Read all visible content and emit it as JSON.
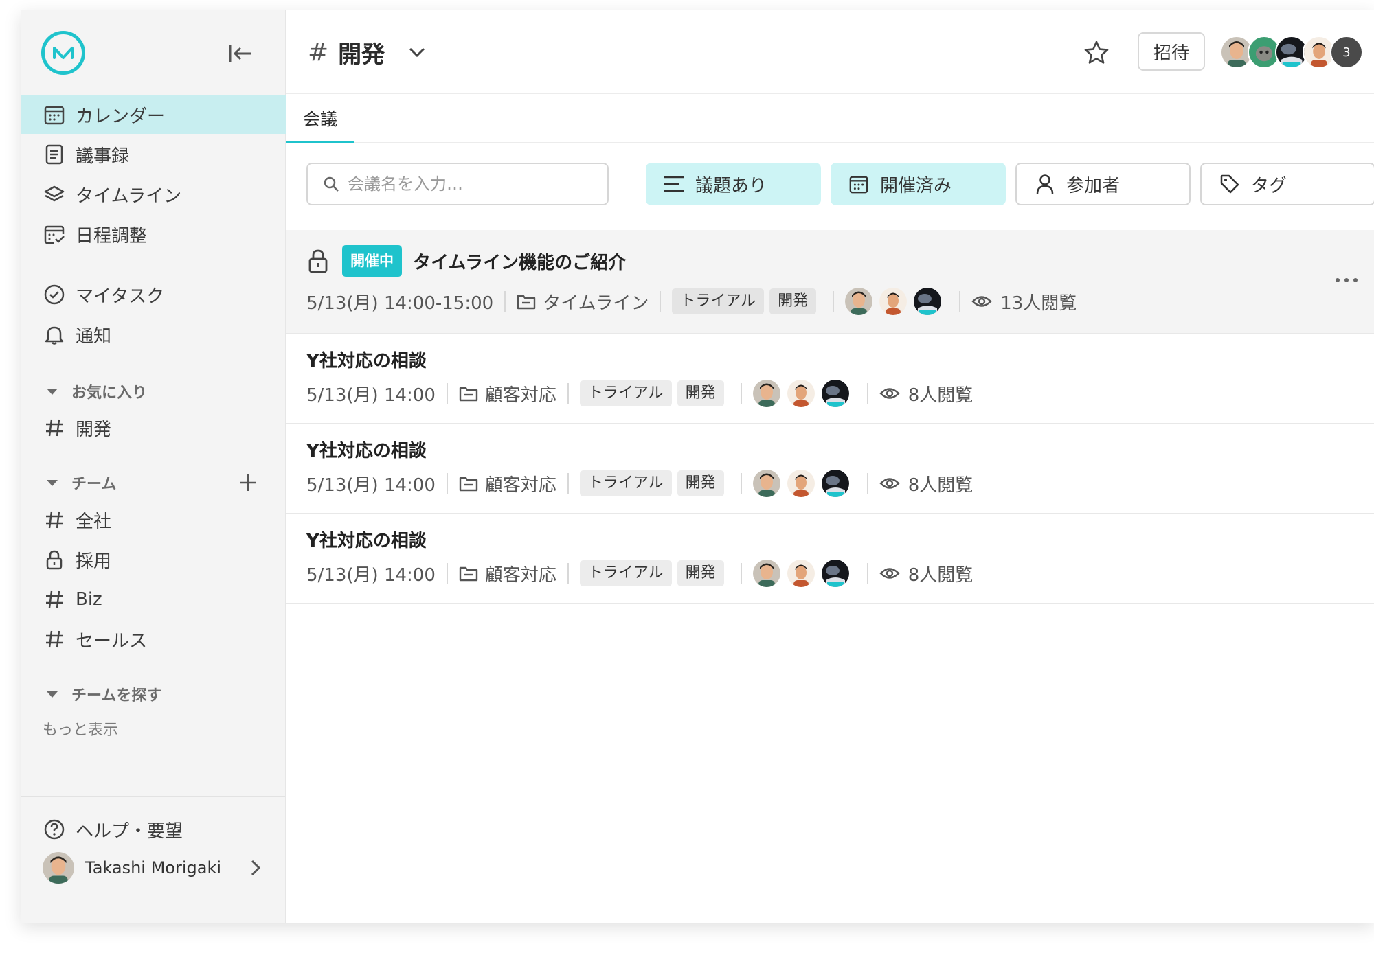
{
  "sidebar": {
    "nav": [
      {
        "label": "カレンダー",
        "icon": "calendar-icon"
      },
      {
        "label": "議事録",
        "icon": "document-icon"
      },
      {
        "label": "タイムライン",
        "icon": "layers-icon"
      },
      {
        "label": "日程調整",
        "icon": "schedule-check-icon"
      },
      {
        "label": "マイタスク",
        "icon": "check-circle-icon"
      },
      {
        "label": "通知",
        "icon": "bell-icon"
      }
    ],
    "favorites_title": "お気に入り",
    "favorites": [
      {
        "label": "開発",
        "icon": "hash-icon"
      }
    ],
    "team_title": "チーム",
    "teams": [
      {
        "label": "全社",
        "icon": "hash-icon"
      },
      {
        "label": "採用",
        "icon": "lock-icon"
      },
      {
        "label": "Biz",
        "icon": "hash-icon"
      },
      {
        "label": "セールス",
        "icon": "hash-icon"
      }
    ],
    "find_team_title": "チームを探す",
    "more_label": "もっと表示",
    "help_label": "ヘルプ・要望",
    "user_name": "Takashi Morigaki"
  },
  "header": {
    "channel_hash": "#",
    "channel_name": "開発",
    "invite_label": "招待",
    "member_overflow": "3"
  },
  "tabs": [
    {
      "label": "会議"
    }
  ],
  "filters": {
    "search_placeholder": "会議名を入力…",
    "agenda_label": "議題あり",
    "held_label": "開催済み",
    "participants_label": "参加者",
    "tags_label": "タグ"
  },
  "meetings": [
    {
      "title": "タイムライン機能のご紹介",
      "status": "開催中",
      "datetime": "5/13(月) 14:00-15:00",
      "folder": "タイムライン",
      "tags": [
        "トライアル",
        "開発"
      ],
      "views": "13人閲覧"
    },
    {
      "title": "Y社対応の相談",
      "datetime": "5/13(月) 14:00",
      "folder": "顧客対応",
      "tags": [
        "トライアル",
        "開発"
      ],
      "views": "8人閲覧"
    },
    {
      "title": "Y社対応の相談",
      "datetime": "5/13(月) 14:00",
      "folder": "顧客対応",
      "tags": [
        "トライアル",
        "開発"
      ],
      "views": "8人閲覧"
    },
    {
      "title": "Y社対応の相談",
      "datetime": "5/13(月) 14:00",
      "folder": "顧客対応",
      "tags": [
        "トライアル",
        "開発"
      ],
      "views": "8人閲覧"
    }
  ],
  "colors": {
    "accent": "#1fc3cc",
    "active_nav": "#c8eef0",
    "filter_on": "#cdf4f5"
  }
}
